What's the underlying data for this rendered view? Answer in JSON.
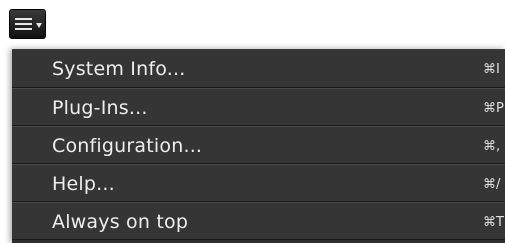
{
  "toolbar": {
    "menu_button": {
      "icon": "hamburger-menu-icon",
      "dropdown_indicator": "caret-down-icon"
    }
  },
  "menu": {
    "items": [
      {
        "label": "System Info...",
        "shortcut": "⌘I"
      },
      {
        "label": "Plug-Ins...",
        "shortcut": "⌘P"
      },
      {
        "label": "Configuration...",
        "shortcut": "⌘,"
      },
      {
        "label": "Help...",
        "shortcut": "⌘/"
      },
      {
        "label": "Always on top",
        "shortcut": "⌘T"
      }
    ]
  }
}
